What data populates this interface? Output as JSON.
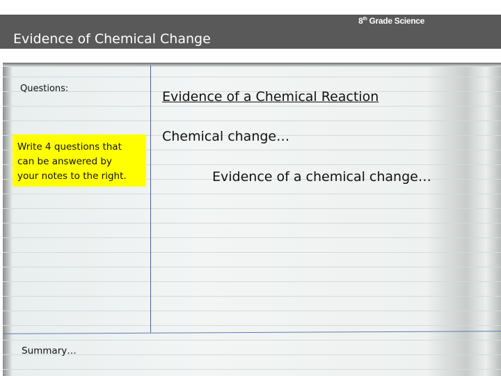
{
  "header": {
    "grade_num": "8",
    "grade_sup": "th",
    "grade_rest": " Grade Science",
    "title": "Evidence of Chemical Change"
  },
  "left": {
    "questions_label": "Questions:",
    "instruction": "Write 4 questions that\ncan be answered by\nyour notes to the right.",
    "summary_label": "Summary…",
    "highlight_color": "#ffff00"
  },
  "right": {
    "heading": "Evidence of a Chemical Reaction",
    "chemical_change": "Chemical change…",
    "evidence": "Evidence of a chemical change…"
  }
}
